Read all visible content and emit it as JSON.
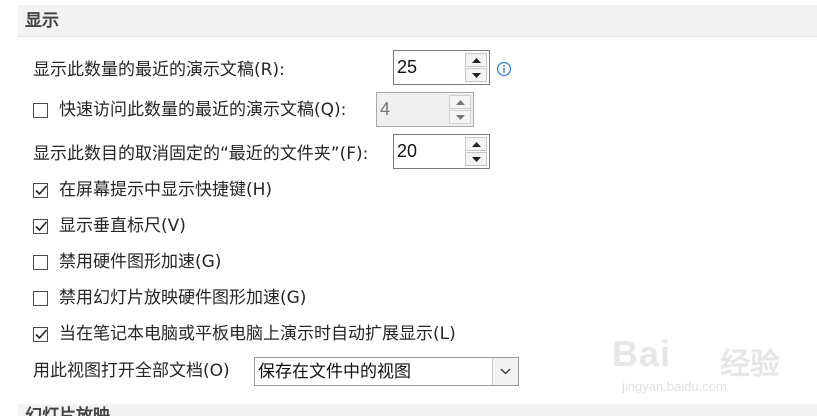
{
  "section": {
    "title": "显示",
    "next_title": "幻灯片放映"
  },
  "recent_presentations": {
    "label": "显示此数量的最近的演示文稿(R):",
    "value": "25"
  },
  "quick_access": {
    "label": "快速访问此数量的最近的演示文稿(Q):",
    "checked": false,
    "value": "4"
  },
  "unpinned_folders": {
    "label": "显示此数目的取消固定的“最近的文件夹”(F):",
    "value": "20"
  },
  "options": [
    {
      "label": "在屏幕提示中显示快捷键(H)",
      "checked": true
    },
    {
      "label": "显示垂直标尺(V)",
      "checked": true
    },
    {
      "label": "禁用硬件图形加速(G)",
      "checked": false
    },
    {
      "label": "禁用幻灯片放映硬件图形加速(G)",
      "checked": false
    },
    {
      "label": "当在笔记本电脑或平板电脑上演示时自动扩展显示(L)",
      "checked": true
    }
  ],
  "open_view": {
    "label": "用此视图打开全部文档(O)",
    "selected": "保存在文件中的视图"
  },
  "watermark": {
    "logo": "Bai",
    "logo_cn": "经验",
    "url": "jingyan.baidu.com"
  },
  "colors": {
    "header_bg": "#f3f3f3",
    "info_icon": "#2b79d0",
    "text": "#262626"
  }
}
